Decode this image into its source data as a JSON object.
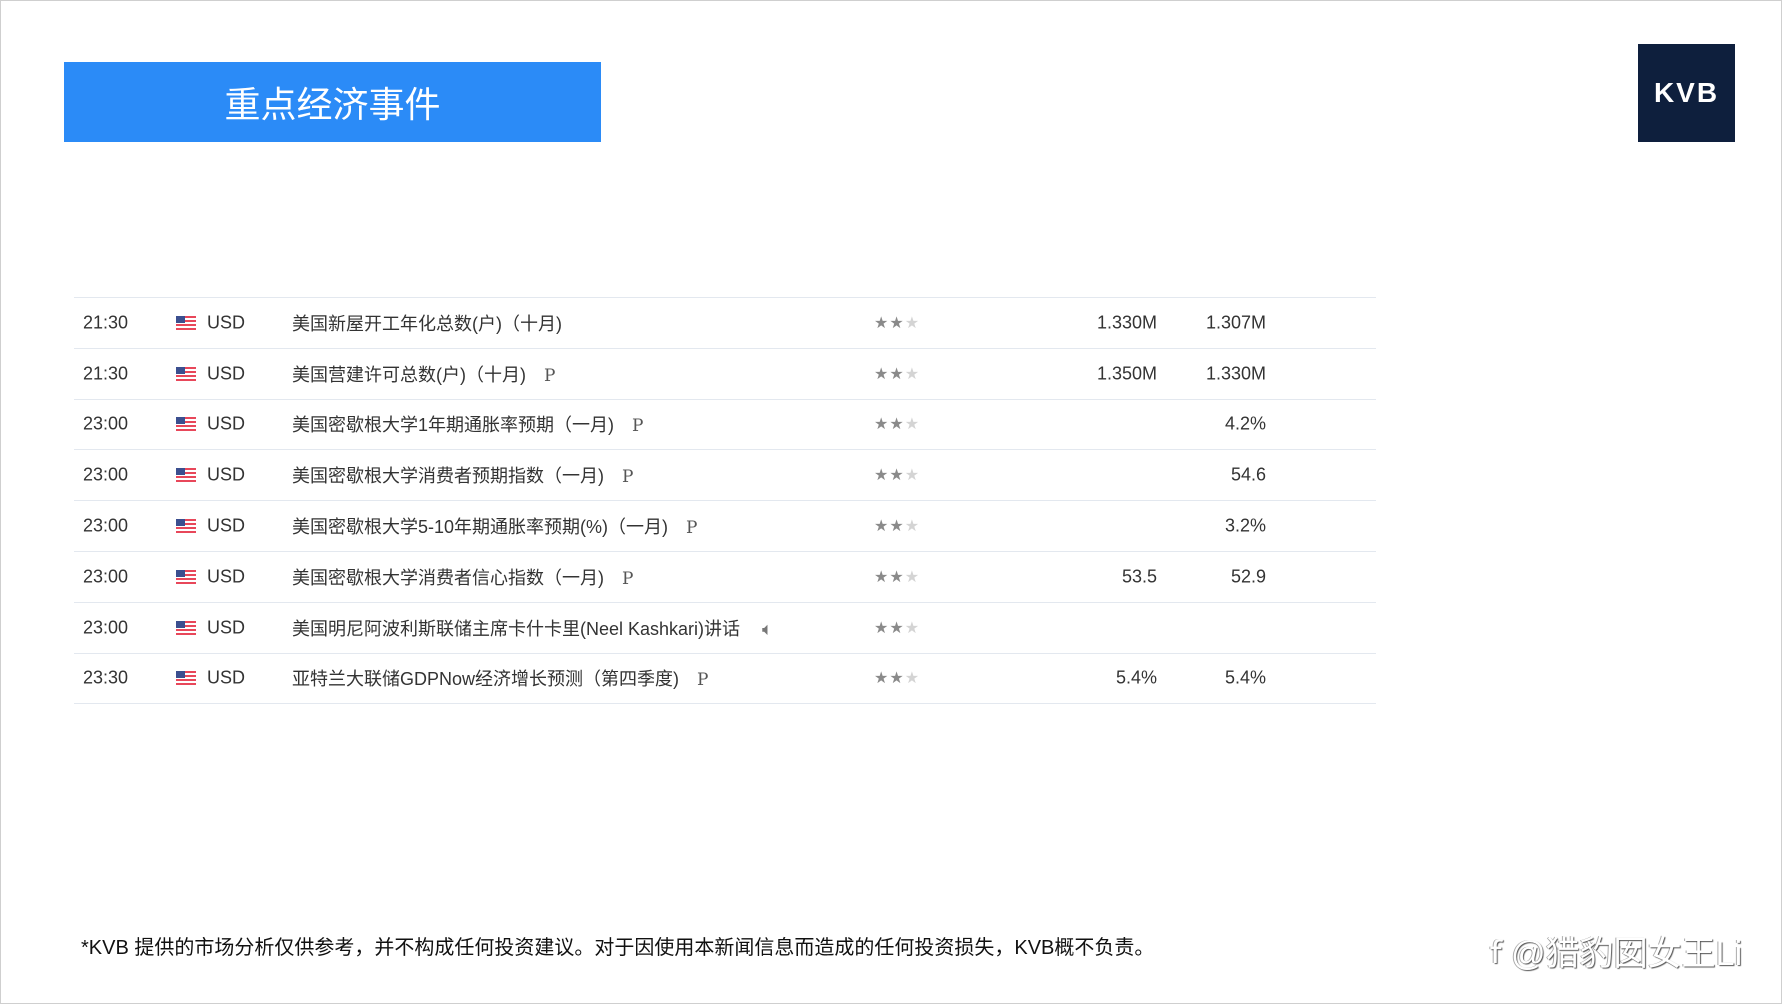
{
  "header": {
    "title": "重点经济事件",
    "logo": "KVB"
  },
  "events": [
    {
      "time": "21:30",
      "currency": "USD",
      "event": "美国新屋开工年化总数(户)（十月)",
      "tag": "",
      "speech": false,
      "stars": 2,
      "actual": "1.330M",
      "forecast": "1.307M"
    },
    {
      "time": "21:30",
      "currency": "USD",
      "event": "美国营建许可总数(户)（十月)",
      "tag": "P",
      "speech": false,
      "stars": 2,
      "actual": "1.350M",
      "forecast": "1.330M"
    },
    {
      "time": "23:00",
      "currency": "USD",
      "event": "美国密歇根大学1年期通胀率预期（一月)",
      "tag": "P",
      "speech": false,
      "stars": 2,
      "actual": "",
      "forecast": "4.2%"
    },
    {
      "time": "23:00",
      "currency": "USD",
      "event": "美国密歇根大学消费者预期指数（一月)",
      "tag": "P",
      "speech": false,
      "stars": 2,
      "actual": "",
      "forecast": "54.6"
    },
    {
      "time": "23:00",
      "currency": "USD",
      "event": "美国密歇根大学5-10年期通胀率预期(%)（一月)",
      "tag": "P",
      "speech": false,
      "stars": 2,
      "actual": "",
      "forecast": "3.2%"
    },
    {
      "time": "23:00",
      "currency": "USD",
      "event": "美国密歇根大学消费者信心指数（一月)",
      "tag": "P",
      "speech": false,
      "stars": 2,
      "actual": "53.5",
      "forecast": "52.9"
    },
    {
      "time": "23:00",
      "currency": "USD",
      "event": "美国明尼阿波利斯联储主席卡什卡里(Neel Kashkari)讲话",
      "tag": "",
      "speech": true,
      "stars": 2,
      "actual": "",
      "forecast": ""
    },
    {
      "time": "23:30",
      "currency": "USD",
      "event": "亚特兰大联储GDPNow经济增长预测（第四季度)",
      "tag": "P",
      "speech": false,
      "stars": 2,
      "actual": "5.4%",
      "forecast": "5.4%"
    }
  ],
  "footer": {
    "disclaimer": "*KVB 提供的市场分析仅供参考，并不构成任何投资建议。对于因使用本新闻信息而造成的任何投资损失，KVB概不负责。",
    "watermark": "@猎豹囡女王Li"
  }
}
